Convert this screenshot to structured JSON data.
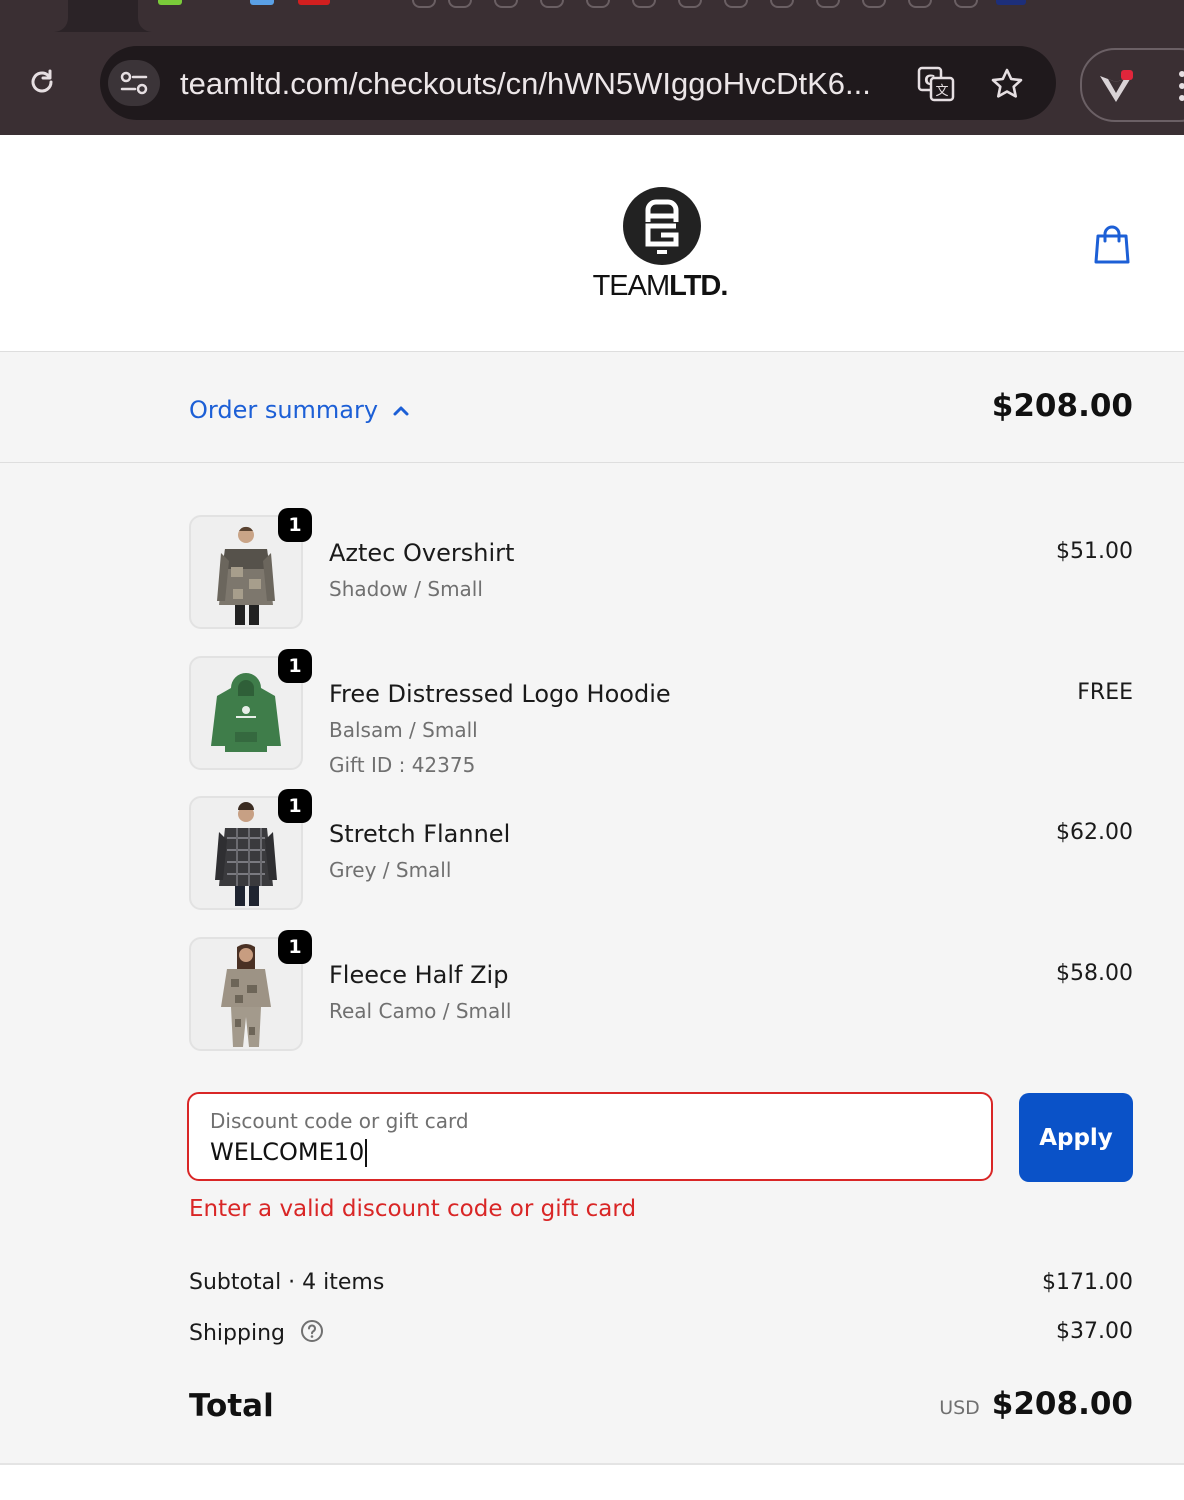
{
  "browser": {
    "url": "teamltd.com/checkouts/cn/hWN5WIggoHvcDtK6..."
  },
  "header": {
    "brand_part1": "TEAM",
    "brand_part2": "LTD."
  },
  "summary": {
    "toggle_label": "Order summary",
    "total": "$208.00"
  },
  "items": [
    {
      "qty": "1",
      "name": "Aztec Overshirt",
      "variant": "Shadow / Small",
      "extra": "",
      "price": "$51.00"
    },
    {
      "qty": "1",
      "name": "Free Distressed Logo Hoodie",
      "variant": "Balsam / Small",
      "extra": "Gift ID : 42375",
      "price": "FREE"
    },
    {
      "qty": "1",
      "name": "Stretch Flannel",
      "variant": "Grey / Small",
      "extra": "",
      "price": "$62.00"
    },
    {
      "qty": "1",
      "name": "Fleece Half Zip",
      "variant": "Real Camo / Small",
      "extra": "",
      "price": "$58.00"
    }
  ],
  "discount": {
    "label": "Discount code or gift card",
    "value": "WELCOME10",
    "apply_label": "Apply",
    "error": "Enter a valid discount code or gift card"
  },
  "totals": {
    "subtotal_label": "Subtotal · 4 items",
    "subtotal_value": "$171.00",
    "shipping_label": "Shipping",
    "shipping_value": "$37.00",
    "total_label": "Total",
    "currency": "USD",
    "total_value": "$208.00"
  },
  "colors": {
    "accent": "#1c5fd6",
    "button": "#0a52c8",
    "error": "#d92626"
  }
}
